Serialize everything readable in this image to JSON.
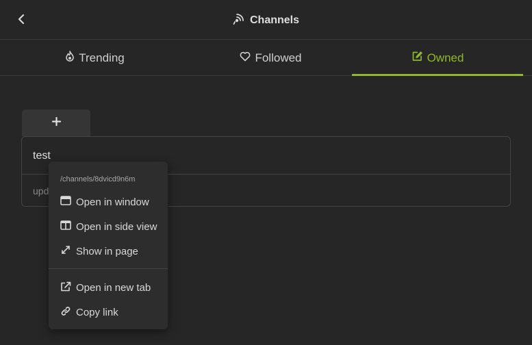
{
  "header": {
    "title": "Channels",
    "title_icon": "broadcast-icon",
    "back_icon": "chevron-left-icon"
  },
  "tabs": [
    {
      "label": "Trending",
      "icon": "flame-icon",
      "active": false
    },
    {
      "label": "Followed",
      "icon": "heart-icon",
      "active": false
    },
    {
      "label": "Owned",
      "icon": "edit-square-icon",
      "active": true
    }
  ],
  "accent_color": "#8fb82a",
  "add_button": {
    "icon": "plus-icon"
  },
  "channel": {
    "name": "test",
    "subtitle": "upd"
  },
  "context_menu": {
    "path": "/channels/8dvicd9n6m",
    "items": [
      {
        "label": "Open in window",
        "icon": "window-icon"
      },
      {
        "label": "Open in side view",
        "icon": "columns-icon"
      },
      {
        "label": "Show in page",
        "icon": "expand-icon"
      },
      {
        "label": "Open in new tab",
        "icon": "external-link-icon"
      },
      {
        "label": "Copy link",
        "icon": "link-icon"
      }
    ]
  }
}
